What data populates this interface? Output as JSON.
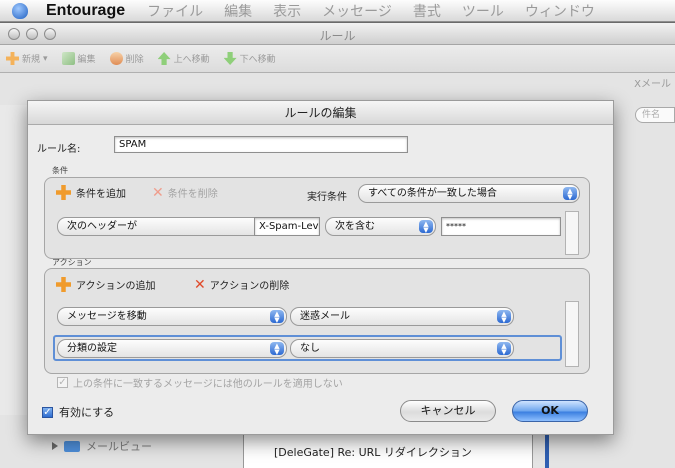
{
  "menubar": {
    "app_name": "Entourage",
    "items": [
      "ファイル",
      "編集",
      "表示",
      "メッセージ",
      "書式",
      "ツール",
      "ウィンドウ"
    ]
  },
  "rules_window": {
    "title": "ルール",
    "toolbar": {
      "new_label": "新規",
      "edit_label": "編集",
      "delete_label": "削除",
      "move_up_label": "上へ移動",
      "move_down_label": "下へ移動"
    },
    "right_label": "Xメール",
    "search_placeholder": "件名",
    "mail_view_label": "メールビュー",
    "message_subject": "[DeleGate] Re: URL リダイレクション"
  },
  "edit_rule": {
    "title": "ルールの編集",
    "rule_name_label": "ルール名:",
    "rule_name_value": "SPAM",
    "conditions": {
      "section_label": "条件",
      "add_label": "条件を追加",
      "remove_label": "条件を削除",
      "execute_label": "実行条件",
      "execute_value": "すべての条件が一致した場合",
      "header_popup": "次のヘッダーが",
      "header_field": "X-Spam-Leve",
      "operator_popup": "次を含む",
      "value_field": "*****"
    },
    "actions": {
      "section_label": "アクション",
      "add_label": "アクションの追加",
      "remove_label": "アクションの削除",
      "rows": [
        {
          "action": "メッセージを移動",
          "value": "迷惑メール"
        },
        {
          "action": "分類の設定",
          "value": "なし"
        }
      ]
    },
    "no_more_rules_label": "上の条件に一致するメッセージには他のルールを適用しない",
    "enabled_label": "有効にする",
    "cancel_label": "キャンセル",
    "ok_label": "OK"
  },
  "colors": {
    "accent_blue": "#3b7fe0",
    "add_orange": "#f09b2c",
    "remove_red": "#e04a2a"
  }
}
